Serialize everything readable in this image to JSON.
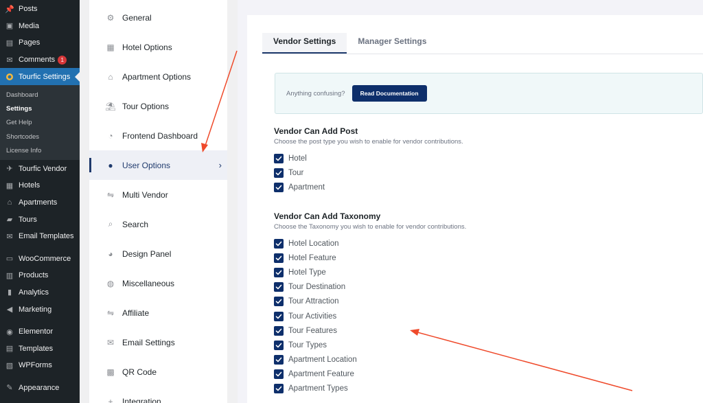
{
  "wp_menu": {
    "items_top": [
      {
        "label": "Posts",
        "icon": "pin-icon",
        "glyph": "📌"
      },
      {
        "label": "Media",
        "icon": "media-icon",
        "glyph": "▣"
      },
      {
        "label": "Pages",
        "icon": "pages-icon",
        "glyph": "▤"
      },
      {
        "label": "Comments",
        "icon": "comments-icon",
        "glyph": "✉",
        "badge": "1"
      }
    ],
    "active": {
      "label": "Tourfic Settings",
      "icon": "tourfic-logo-icon"
    },
    "submenu": [
      "Dashboard",
      "Settings",
      "Get Help",
      "Shortcodes",
      "License Info"
    ],
    "submenu_current": "Settings",
    "items_bottom": [
      {
        "label": "Tourfic Vendor",
        "icon": "vendor-icon",
        "glyph": "✈"
      },
      {
        "label": "Hotels",
        "icon": "hotel-icon",
        "glyph": "▦"
      },
      {
        "label": "Apartments",
        "icon": "apartment-icon",
        "glyph": "⌂"
      },
      {
        "label": "Tours",
        "icon": "tours-icon",
        "glyph": "▰"
      },
      {
        "label": "Email Templates",
        "icon": "email-icon",
        "glyph": "✉"
      },
      {
        "gap": true
      },
      {
        "label": "WooCommerce",
        "icon": "woocommerce-icon",
        "glyph": "▭"
      },
      {
        "label": "Products",
        "icon": "products-icon",
        "glyph": "▥"
      },
      {
        "label": "Analytics",
        "icon": "analytics-icon",
        "glyph": "▮"
      },
      {
        "label": "Marketing",
        "icon": "marketing-icon",
        "glyph": "◀"
      },
      {
        "gap": true
      },
      {
        "label": "Elementor",
        "icon": "elementor-icon",
        "glyph": "◉"
      },
      {
        "label": "Templates",
        "icon": "templates-icon",
        "glyph": "▤"
      },
      {
        "label": "WPForms",
        "icon": "wpforms-icon",
        "glyph": "▧"
      },
      {
        "gap": true
      },
      {
        "label": "Appearance",
        "icon": "appearance-icon",
        "glyph": "✎"
      }
    ]
  },
  "settings_nav": [
    {
      "label": "General",
      "icon": "gear-icon",
      "glyph": "⚙"
    },
    {
      "label": "Hotel Options",
      "icon": "building-icon",
      "glyph": "▦"
    },
    {
      "label": "Apartment Options",
      "icon": "house-icon",
      "glyph": "⌂"
    },
    {
      "label": "Tour Options",
      "icon": "umbrella-icon",
      "glyph": "⛱"
    },
    {
      "label": "Frontend Dashboard",
      "icon": "dashboard-gauge-icon",
      "glyph": "◔"
    },
    {
      "label": "User Options",
      "icon": "user-icon",
      "glyph": "●",
      "active": true
    },
    {
      "label": "Multi Vendor",
      "icon": "handshake-icon",
      "glyph": "⇋"
    },
    {
      "label": "Search",
      "icon": "search-icon",
      "glyph": "⌕"
    },
    {
      "label": "Design Panel",
      "icon": "palette-icon",
      "glyph": "◕"
    },
    {
      "label": "Miscellaneous",
      "icon": "globe-icon",
      "glyph": "◍"
    },
    {
      "label": "Affiliate",
      "icon": "handshake-icon",
      "glyph": "⇋"
    },
    {
      "label": "Email Settings",
      "icon": "envelope-icon",
      "glyph": "✉"
    },
    {
      "label": "QR Code",
      "icon": "qr-code-icon",
      "glyph": "▩"
    },
    {
      "label": "Integration",
      "icon": "plus-icon",
      "glyph": "+"
    }
  ],
  "tabs": [
    {
      "label": "Vendor Settings",
      "active": true
    },
    {
      "label": "Manager Settings",
      "active": false
    }
  ],
  "notice": {
    "text": "Anything confusing?",
    "button": "Read Documentation"
  },
  "post_section": {
    "title": "Vendor Can Add Post",
    "desc": "Choose the post type you wish to enable for vendor contributions.",
    "options": [
      "Hotel",
      "Tour",
      "Apartment"
    ]
  },
  "taxonomy_section": {
    "title": "Vendor Can Add Taxonomy",
    "desc": "Choose the Taxonomy you wish to enable for vendor contributions.",
    "options": [
      "Hotel Location",
      "Hotel Feature",
      "Hotel Type",
      "Tour Destination",
      "Tour Attraction",
      "Tour Activities",
      "Tour Features",
      "Tour Types",
      "Apartment Location",
      "Apartment Feature",
      "Apartment Types"
    ]
  },
  "colors": {
    "wp_sidebar": "#1d2327",
    "wp_active": "#2271b1",
    "brand_navy": "#0e2f6b",
    "annotation_arrow": "#ef4a2b"
  }
}
